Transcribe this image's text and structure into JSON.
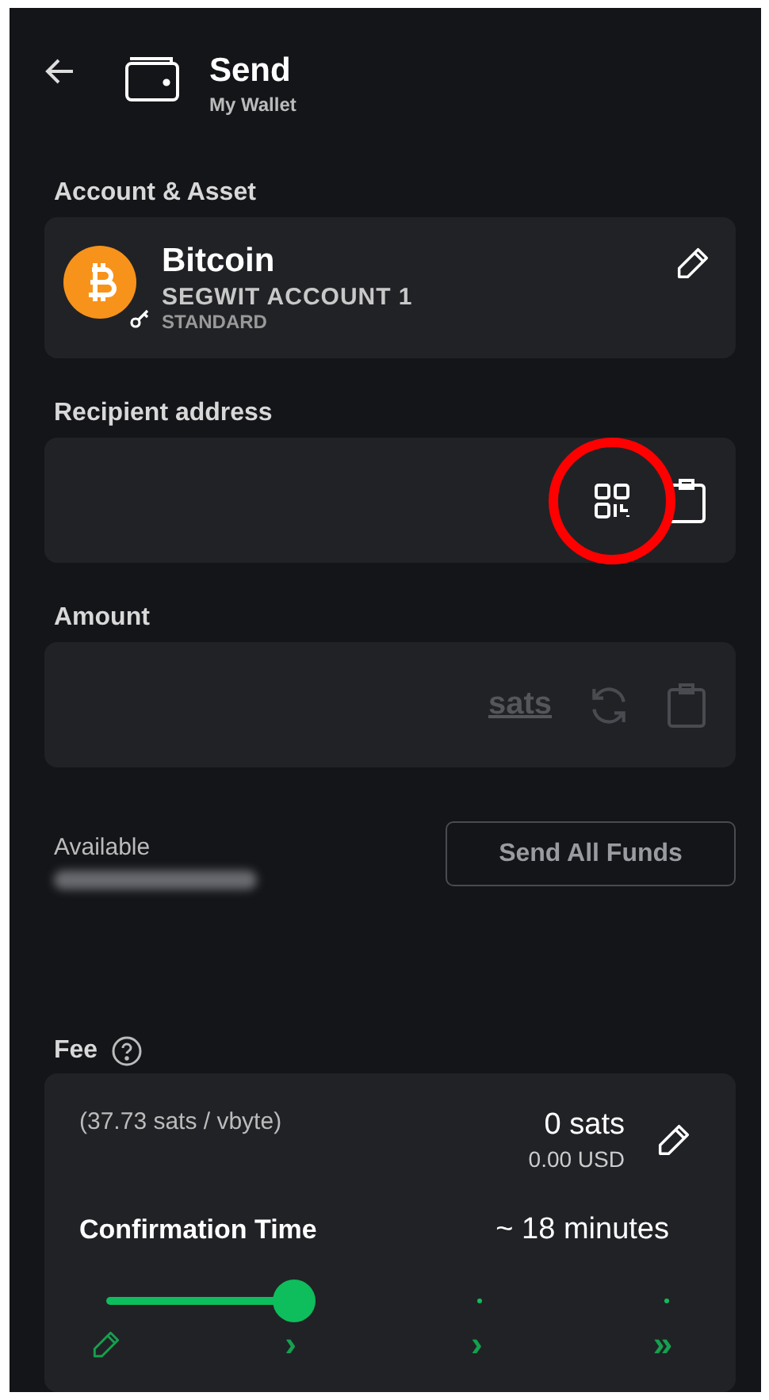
{
  "header": {
    "title": "Send",
    "subtitle": "My Wallet"
  },
  "account": {
    "label": "Account & Asset",
    "asset": "Bitcoin",
    "account_name": "SEGWIT ACCOUNT 1",
    "account_type": "STANDARD"
  },
  "recipient": {
    "label": "Recipient address",
    "qr_highlighted": true
  },
  "amount": {
    "label": "Amount",
    "unit": "sats"
  },
  "available": {
    "label": "Available",
    "value_redacted": true,
    "button": "Send All Funds"
  },
  "fee": {
    "label": "Fee",
    "rate": "(37.73 sats / vbyte)",
    "amount": "0 sats",
    "fiat": "0.00 USD",
    "time_label": "Confirmation Time",
    "time_value": "~ 18 minutes",
    "level": 0.3333,
    "steps": [
      {
        "kind": "custom"
      },
      {
        "kind": "text",
        "text": "›"
      },
      {
        "kind": "text",
        "text": "›"
      },
      {
        "kind": "text",
        "text": "»"
      }
    ]
  }
}
